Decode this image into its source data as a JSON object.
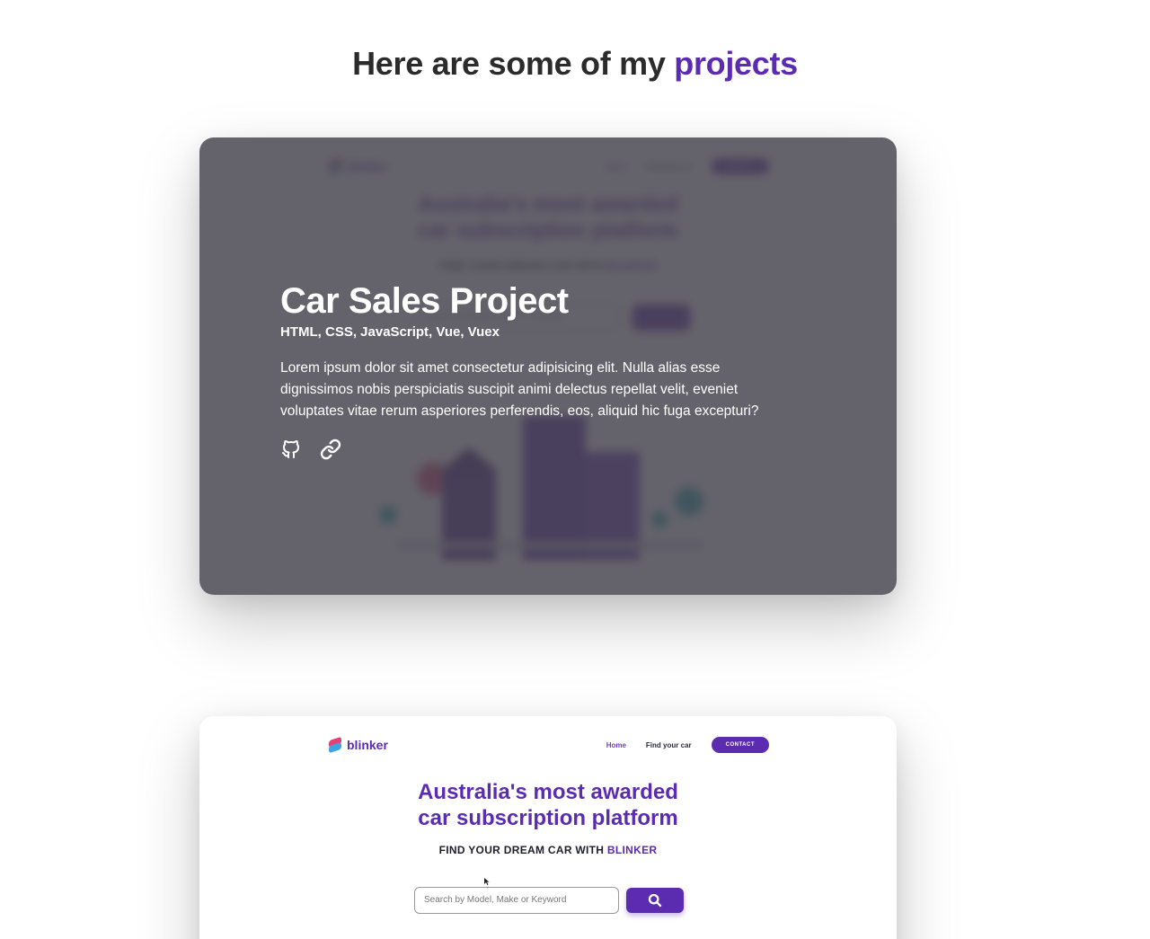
{
  "heading": {
    "prefix": "Here are some of my",
    "accent": "projects"
  },
  "project": {
    "title": "Car Sales Project",
    "tech": "HTML, CSS, JavaScript, Vue, Vuex",
    "description": "Lorem ipsum dolor sit amet consectetur adipisicing elit. Nulla alias esse dignissimos nobis perspiciatis suscipit animi delectus repellat velit, eveniet voluptates vitae rerum asperiores perferendis, eos, aliquid hic fuga excepturi?",
    "links": [
      {
        "icon": "github-icon"
      },
      {
        "icon": "link-icon"
      }
    ]
  },
  "preview_site": {
    "logo": "blinker",
    "nav": {
      "home": "Home",
      "find": "Find your car",
      "contact": "CONTACT"
    },
    "hero_line1": "Australia's most awarded",
    "hero_line2": "car subscription platform",
    "subtitle_prefix": "FIND YOUR DREAM CAR WITH",
    "subtitle_brand": "BLINKER",
    "search_placeholder": "Search by Model, Make or Keyword"
  },
  "colors": {
    "accent": "#5b2bb0",
    "overlay": "#46444e",
    "text_dark": "#2b2b2b"
  }
}
